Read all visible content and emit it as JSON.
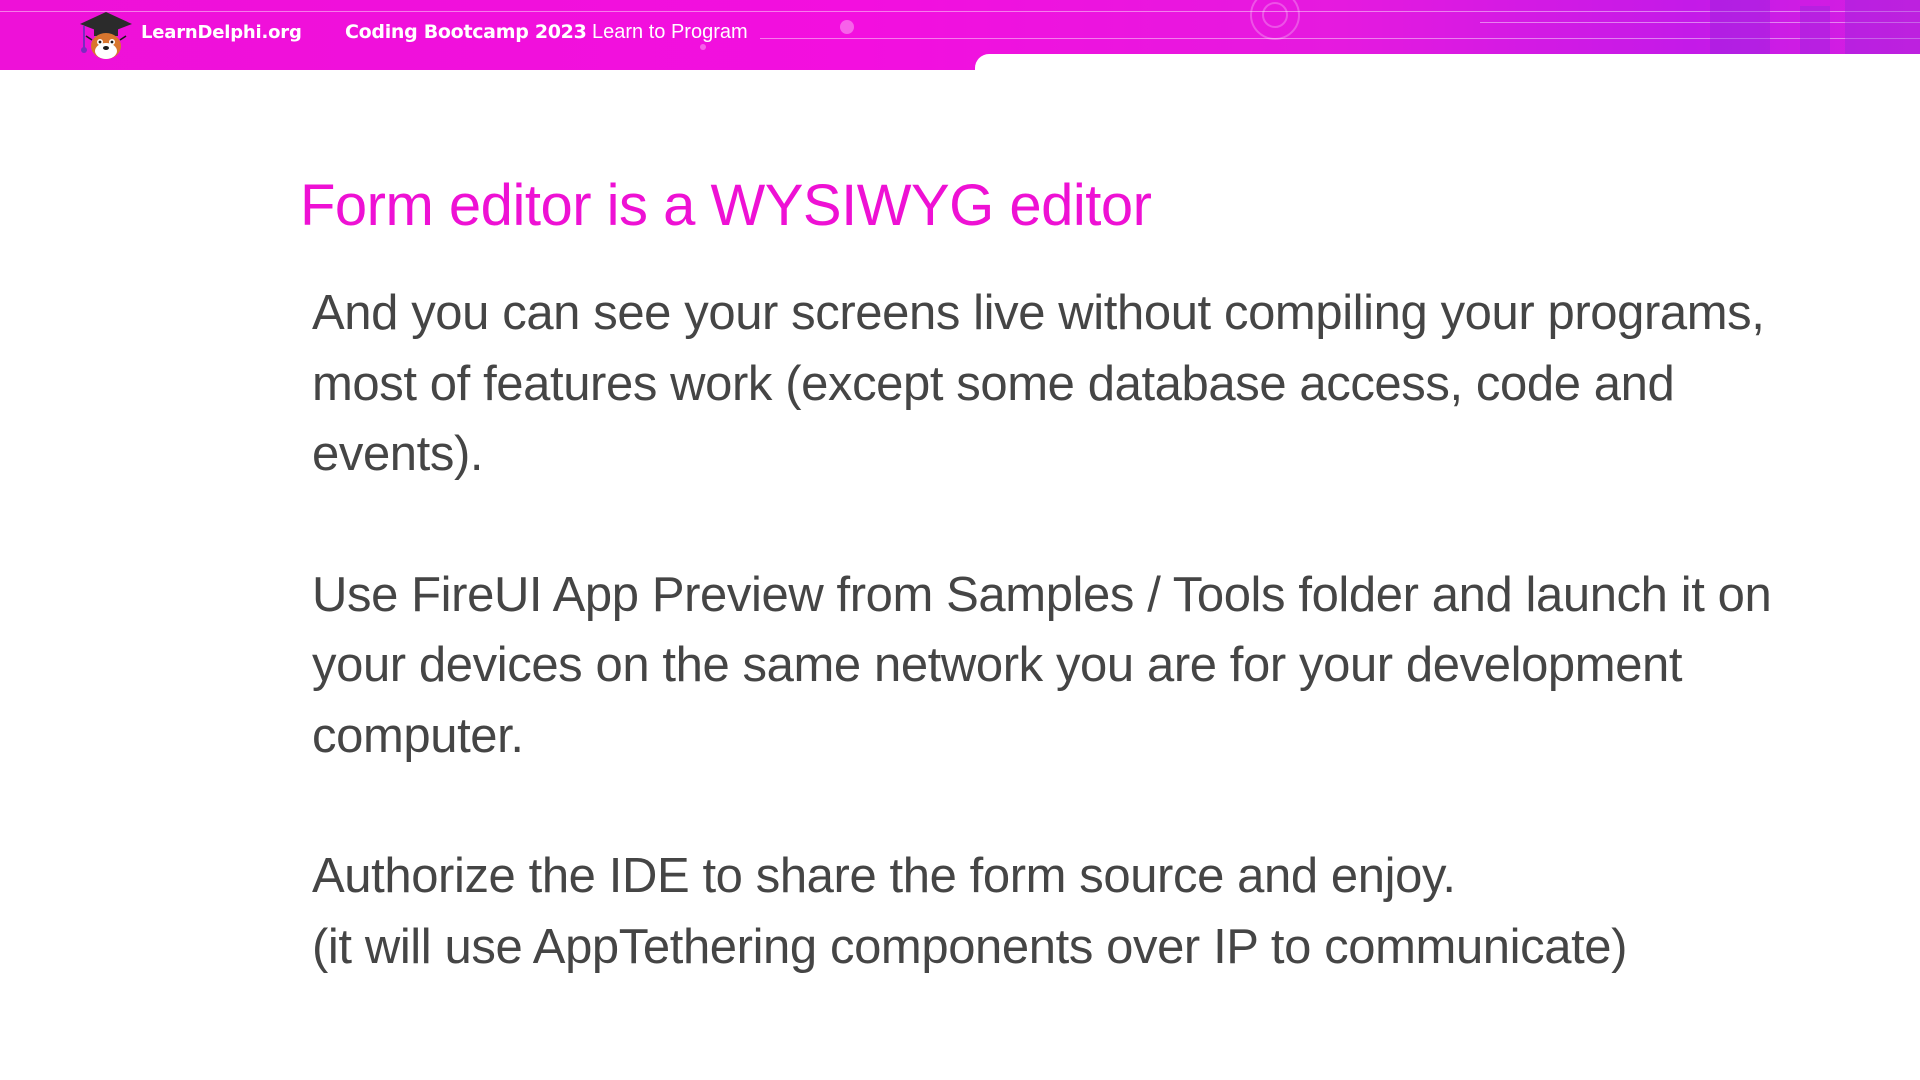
{
  "header": {
    "brand": "LearnDelphi.org",
    "course": "Coding Bootcamp 2023",
    "tagline": "Learn to Program"
  },
  "slide": {
    "title": "Form editor is a WYSIWYG editor",
    "paragraphs": [
      "And you can see your screens live without compiling your programs, most of features work (except some database access, code and events).",
      "Use FireUI App Preview from Samples / Tools folder and launch it on your devices on the same network you are for your development computer."
    ],
    "last_lines": [
      "Authorize the IDE to share the form source and enjoy.",
      "(it will use AppTethering components over IP to communicate)"
    ]
  },
  "colors": {
    "header_bar": "#ee11d8",
    "title": "#ee11d4",
    "body_text": "#454545"
  },
  "icons": {
    "logo": "graduation-cap-mascot-logo"
  }
}
